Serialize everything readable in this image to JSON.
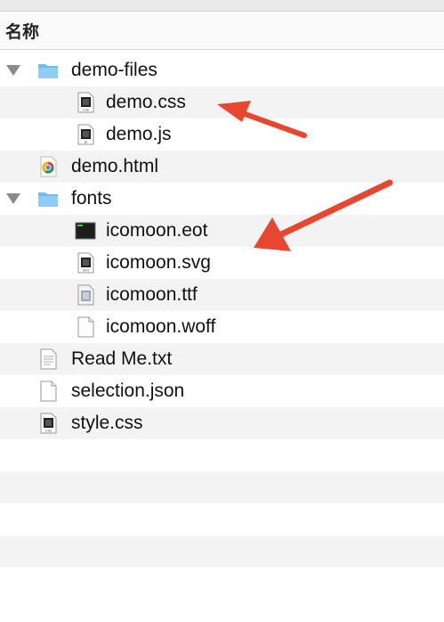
{
  "header": {
    "column_label": "名称"
  },
  "files": [
    {
      "name": "demo-files",
      "kind": "folder",
      "level": 0,
      "expanded": true,
      "icon": "folder-icon"
    },
    {
      "name": "demo.css",
      "kind": "css",
      "level": 1,
      "icon": "css-file-icon",
      "badge": "CSS"
    },
    {
      "name": "demo.js",
      "kind": "js",
      "level": 1,
      "icon": "js-file-icon",
      "badge": "JS"
    },
    {
      "name": "demo.html",
      "kind": "html",
      "level": 0,
      "icon": "chrome-html-icon"
    },
    {
      "name": "fonts",
      "kind": "folder",
      "level": 0,
      "expanded": true,
      "icon": "folder-icon"
    },
    {
      "name": "icomoon.eot",
      "kind": "eot",
      "level": 1,
      "icon": "terminal-file-icon"
    },
    {
      "name": "icomoon.svg",
      "kind": "svg",
      "level": 1,
      "icon": "svg-file-icon",
      "badge": "SVG"
    },
    {
      "name": "icomoon.ttf",
      "kind": "ttf",
      "level": 1,
      "icon": "font-file-icon"
    },
    {
      "name": "icomoon.woff",
      "kind": "blank",
      "level": 1,
      "icon": "blank-file-icon"
    },
    {
      "name": "Read Me.txt",
      "kind": "txt",
      "level": 0,
      "icon": "text-file-icon"
    },
    {
      "name": "selection.json",
      "kind": "blank",
      "level": 0,
      "icon": "blank-file-icon"
    },
    {
      "name": "style.css",
      "kind": "css",
      "level": 0,
      "icon": "css-file-icon",
      "badge": "CSS"
    }
  ],
  "colors": {
    "arrow": "#e8462f",
    "folder": "#6cbcf3",
    "row_alt": "#f3f3f3"
  }
}
